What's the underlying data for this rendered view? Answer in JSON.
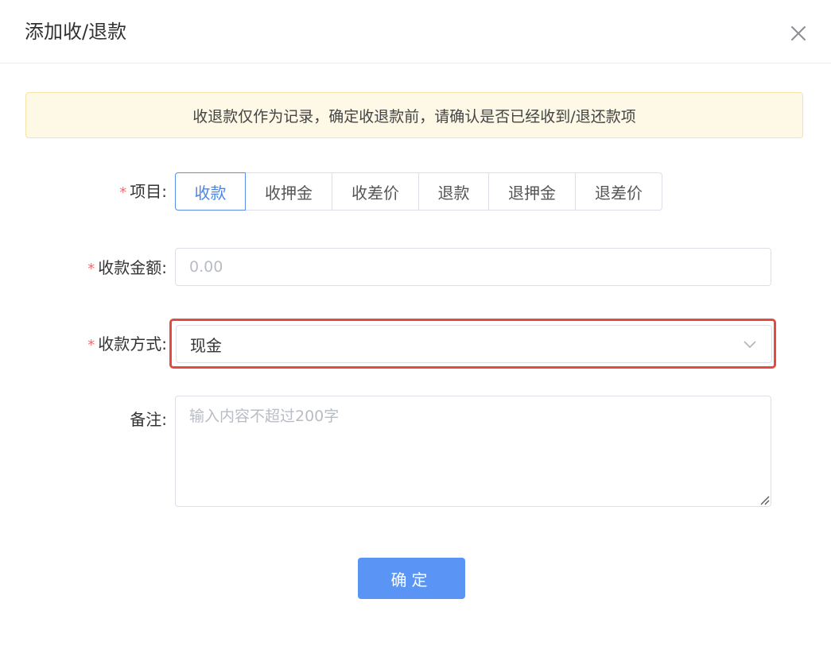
{
  "dialog": {
    "title": "添加收/退款",
    "close_icon": "close-icon"
  },
  "notice": {
    "text": "收退款仅作为记录，确定收退款前，请确认是否已经收到/退还款项"
  },
  "form": {
    "required_mark": "*",
    "item": {
      "label": "项目:",
      "options": [
        "收款",
        "收押金",
        "收差价",
        "退款",
        "退押金",
        "退差价"
      ],
      "selected": "收款"
    },
    "amount": {
      "label": "收款金额:",
      "placeholder": "0.00",
      "value": ""
    },
    "method": {
      "label": "收款方式:",
      "value": "现金",
      "icon": "chevron-down-icon"
    },
    "remark": {
      "label": "备注:",
      "placeholder": "输入内容不超过200字",
      "value": ""
    }
  },
  "actions": {
    "confirm_label": "确定"
  },
  "colors": {
    "accent": "#5a95f5",
    "active_border": "#5a8ee6",
    "required": "#f56c6c",
    "highlight": "#e44a40",
    "notice_bg": "#fdf9e6"
  }
}
